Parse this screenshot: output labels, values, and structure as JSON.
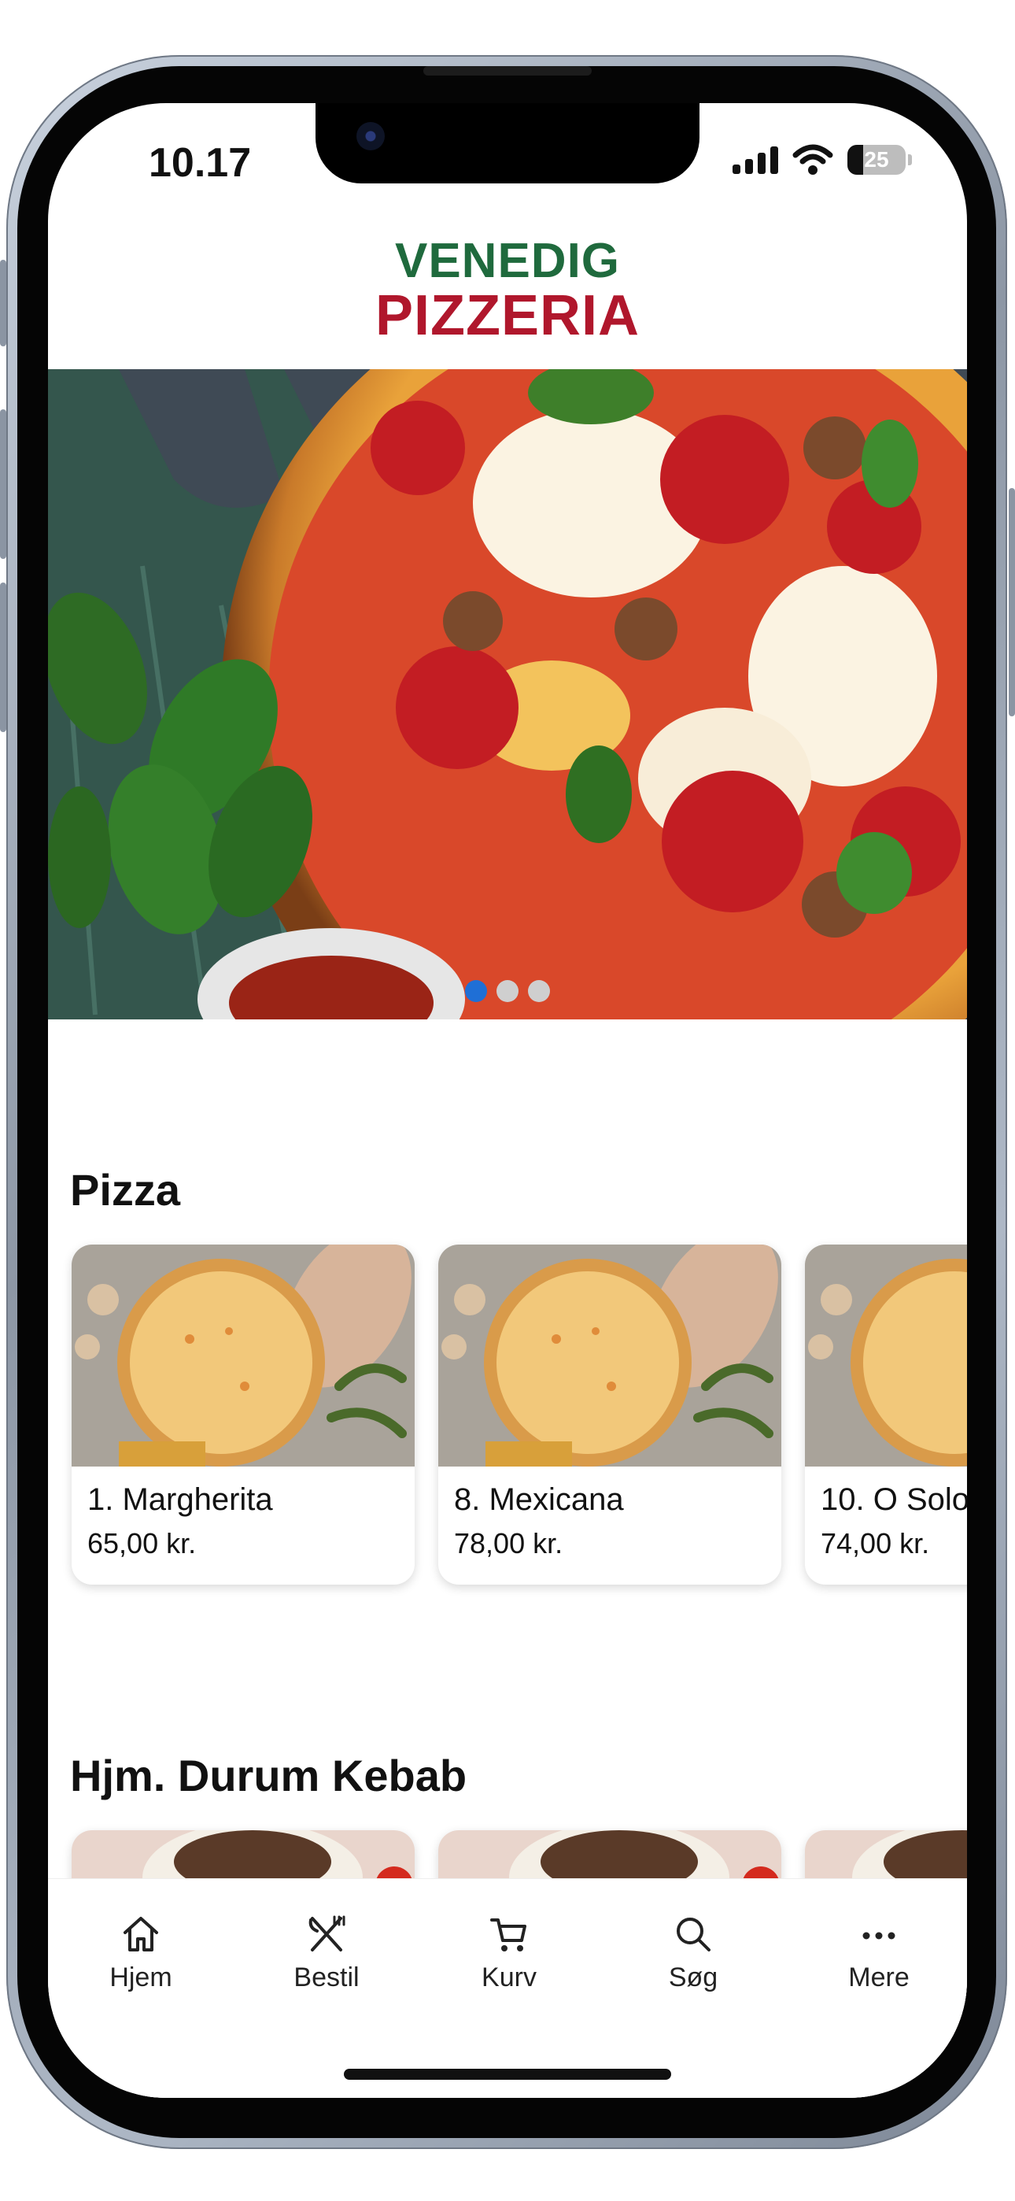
{
  "status_bar": {
    "time": "10.17",
    "battery": "25"
  },
  "logo": {
    "line1": "VENEDIG",
    "line2": "PIZZERIA"
  },
  "carousel": {
    "pages": 3,
    "active": 1
  },
  "sections": [
    {
      "title": "Pizza",
      "items": [
        {
          "name": "1. Margherita",
          "price": "65,00 kr."
        },
        {
          "name": "8. Mexicana",
          "price": "78,00 kr."
        },
        {
          "name": "10. O Solo",
          "price": "74,00 kr."
        }
      ]
    },
    {
      "title": "Hjm. Durum Kebab",
      "items": [
        {},
        {},
        {}
      ]
    }
  ],
  "tabbar": {
    "items": [
      {
        "label": "Hjem",
        "icon": "home-icon"
      },
      {
        "label": "Bestil",
        "icon": "utensils-icon"
      },
      {
        "label": "Kurv",
        "icon": "cart-icon"
      },
      {
        "label": "Søg",
        "icon": "search-icon"
      },
      {
        "label": "Mere",
        "icon": "more-icon"
      }
    ]
  },
  "colors": {
    "logo_green": "#1f6a3d",
    "logo_red": "#b0172c",
    "dot_active": "#1f6fd6"
  }
}
